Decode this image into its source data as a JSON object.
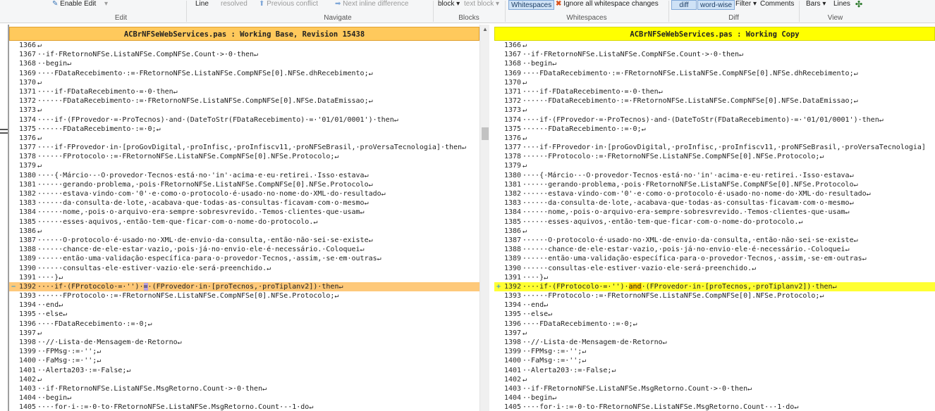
{
  "ribbon": {
    "enable_edit": "Enable Edit",
    "line": "Line",
    "resolved": "resolved",
    "previous_conflict": "Previous conflict",
    "next_inline_difference": "Next inline difference",
    "block": "block",
    "text_block": "text block",
    "whitespaces": "Whitespaces",
    "ignore_whitespace": "Ignore all whitespace changes",
    "diff": "diff",
    "word_wise": "word-wise",
    "filter": "Filter",
    "comments": "Comments",
    "bars": "Bars",
    "lines": "Lines",
    "groups": {
      "edit": "Edit",
      "navigate": "Navigate",
      "blocks": "Blocks",
      "whitespaces": "Whitespaces",
      "diff": "Diff",
      "view": "View"
    },
    "colors": {
      "accent": "#cfe2f6",
      "close_x": "#d9531e"
    },
    "icons": [
      "edit-icon",
      "up-arrow-icon",
      "right-arrow-icon",
      "close-x-icon",
      "bars-dropdown-icon",
      "lines-icon",
      "dropdown-chevron-icon"
    ]
  },
  "left_pane": {
    "title": "ACBrNFSeWebServices.pas : Working Base, Revision 15438",
    "header_color": "#ffc95c",
    "changed_color": "#fec97a",
    "highlight_color": "#b9a0e0",
    "marker": "−",
    "lines": [
      {
        "n": "1366",
        "t": "↵"
      },
      {
        "n": "1367",
        "t": "··if·FRetornoNFSe.ListaNFSe.CompNFSe.Count·>·0·then↵"
      },
      {
        "n": "1368",
        "t": "··begin↵"
      },
      {
        "n": "1369",
        "t": "····FDataRecebimento·:=·FRetornoNFSe.ListaNFSe.CompNFSe[0].NFSe.dhRecebimento;↵"
      },
      {
        "n": "1370",
        "t": "↵"
      },
      {
        "n": "1371",
        "t": "····if·FDataRecebimento·=·0·then↵"
      },
      {
        "n": "1372",
        "t": "······FDataRecebimento·:=·FRetornoNFSe.ListaNFSe.CompNFSe[0].NFSe.DataEmissao;↵"
      },
      {
        "n": "1373",
        "t": "↵"
      },
      {
        "n": "1374",
        "t": "····if·(FProvedor·=·ProTecnos)·and·(DateToStr(FDataRecebimento)·=·'01/01/0001')·then↵"
      },
      {
        "n": "1375",
        "t": "······FDataRecebimento·:=·0;↵"
      },
      {
        "n": "1376",
        "t": "↵"
      },
      {
        "n": "1377",
        "t": "····if·FProvedor·in·[proGovDigital,·proInfisc,·proInfiscv11,·proNFSeBrasil,·proVersaTecnologia]·then↵"
      },
      {
        "n": "1378",
        "t": "······FProtocolo·:=·FRetornoNFSe.ListaNFSe.CompNFSe[0].NFSe.Protocolo;↵"
      },
      {
        "n": "1379",
        "t": "↵"
      },
      {
        "n": "1380",
        "t": "····{·Márcio·-·O·provedor·Tecnos·está·no·'in'·acima·e·eu·retirei.·Isso·estava↵"
      },
      {
        "n": "1381",
        "t": "······gerando·problema,·pois·FRetornoNFSe.ListaNFSe.CompNFSe[0].NFSe.Protocolo↵"
      },
      {
        "n": "1382",
        "t": "······estava·vindo·com·'0'·e·como·o·protocolo·é·usado·no·nome·do·XML·do·resultado↵"
      },
      {
        "n": "1383",
        "t": "······da·consulta·de·lote,·acabava·que·todas·as·consultas·ficavam·com·o·mesmo↵"
      },
      {
        "n": "1384",
        "t": "······nome,·pois·o·arquivo·era·sempre·sobresvrevido.·Temos·clientes·que·usam↵"
      },
      {
        "n": "1385",
        "t": "······esses·aquivos,·então·tem·que·ficar·com·o·nome·do·protocolo.↵"
      },
      {
        "n": "1386",
        "t": "↵"
      },
      {
        "n": "1387",
        "t": "······O·protocolo·é·usado·no·XML·de·envio·da·consulta,·então·não·sei·se·existe↵"
      },
      {
        "n": "1388",
        "t": "······chance·de·ele·estar·vazio,·pois·já·no·envio·ele·é·necessário.·Coloquei↵"
      },
      {
        "n": "1389",
        "t": "······então·uma·validação·específica·para·o·provedor·Tecnos,·assim,·se·em·outras↵"
      },
      {
        "n": "1390",
        "t": "······consultas·ele·estiver·vazio·ele·será·preenchido.↵"
      },
      {
        "n": "1391",
        "t": "····}↵"
      },
      {
        "n": "1392",
        "a": "····if·(FProtocolo·=·'')·",
        "h": "=",
        "b": "·(FProvedor·in·[proTecnos,·proTiplanv2])·then↵",
        "changed": true
      },
      {
        "n": "1393",
        "t": "······FProtocolo·:=·FRetornoNFSe.ListaNFSe.CompNFSe[0].NFSe.Protocolo;↵"
      },
      {
        "n": "1394",
        "t": "··end↵"
      },
      {
        "n": "1395",
        "t": "··else↵"
      },
      {
        "n": "1396",
        "t": "····FDataRecebimento·:=·0;↵"
      },
      {
        "n": "1397",
        "t": "↵"
      },
      {
        "n": "1398",
        "t": "··//·Lista·de·Mensagem·de·Retorno↵"
      },
      {
        "n": "1399",
        "t": "··FPMsg·:=·'';↵"
      },
      {
        "n": "1400",
        "t": "··FaMsg·:=·'';↵"
      },
      {
        "n": "1401",
        "t": "··Alerta203·:=·False;↵"
      },
      {
        "n": "1402",
        "t": "↵"
      },
      {
        "n": "1403",
        "t": "··if·FRetornoNFSe.ListaNFSe.MsgRetorno.Count·>·0·then↵"
      },
      {
        "n": "1404",
        "t": "··begin↵"
      },
      {
        "n": "1405",
        "t": "····for·i·:=·0·to·FRetornoNFSe.ListaNFSe.MsgRetorno.Count·-·1·do↵"
      }
    ]
  },
  "right_pane": {
    "title": "ACBrNFSeWebServices.pas : Working Copy",
    "header_color": "#ffff00",
    "changed_color": "#ffff33",
    "highlight_color": "#ffd000",
    "marker": "+",
    "lines": [
      {
        "n": "1366",
        "t": "↵"
      },
      {
        "n": "1367",
        "t": "··if·FRetornoNFSe.ListaNFSe.CompNFSe.Count·>·0·then↵"
      },
      {
        "n": "1368",
        "t": "··begin↵"
      },
      {
        "n": "1369",
        "t": "····FDataRecebimento·:=·FRetornoNFSe.ListaNFSe.CompNFSe[0].NFSe.dhRecebimento;↵"
      },
      {
        "n": "1370",
        "t": "↵"
      },
      {
        "n": "1371",
        "t": "····if·FDataRecebimento·=·0·then↵"
      },
      {
        "n": "1372",
        "t": "······FDataRecebimento·:=·FRetornoNFSe.ListaNFSe.CompNFSe[0].NFSe.DataEmissao;↵"
      },
      {
        "n": "1373",
        "t": "↵"
      },
      {
        "n": "1374",
        "t": "····if·(FProvedor·=·ProTecnos)·and·(DateToStr(FDataRecebimento)·=·'01/01/0001')·then↵"
      },
      {
        "n": "1375",
        "t": "······FDataRecebimento·:=·0;↵"
      },
      {
        "n": "1376",
        "t": "↵"
      },
      {
        "n": "1377",
        "t": "····if·FProvedor·in·[proGovDigital,·proInfisc,·proInfiscv11,·proNFSeBrasil,·proVersaTecnologia]"
      },
      {
        "n": "1378",
        "t": "······FProtocolo·:=·FRetornoNFSe.ListaNFSe.CompNFSe[0].NFSe.Protocolo;↵"
      },
      {
        "n": "1379",
        "t": "↵"
      },
      {
        "n": "1380",
        "t": "····{·Márcio·-·O·provedor·Tecnos·está·no·'in'·acima·e·eu·retirei.·Isso·estava↵"
      },
      {
        "n": "1381",
        "t": "······gerando·problema,·pois·FRetornoNFSe.ListaNFSe.CompNFSe[0].NFSe.Protocolo↵"
      },
      {
        "n": "1382",
        "t": "······estava·vindo·com·'0'·e·como·o·protocolo·é·usado·no·nome·do·XML·do·resultado↵"
      },
      {
        "n": "1383",
        "t": "······da·consulta·de·lote,·acabava·que·todas·as·consultas·ficavam·com·o·mesmo↵"
      },
      {
        "n": "1384",
        "t": "······nome,·pois·o·arquivo·era·sempre·sobresvrevido.·Temos·clientes·que·usam↵"
      },
      {
        "n": "1385",
        "t": "······esses·aquivos,·então·tem·que·ficar·com·o·nome·do·protocolo.↵"
      },
      {
        "n": "1386",
        "t": "↵"
      },
      {
        "n": "1387",
        "t": "······O·protocolo·é·usado·no·XML·de·envio·da·consulta,·então·não·sei·se·existe↵"
      },
      {
        "n": "1388",
        "t": "······chance·de·ele·estar·vazio,·pois·já·no·envio·ele·é·necessário.·Coloquei↵"
      },
      {
        "n": "1389",
        "t": "······então·uma·validação·específica·para·o·provedor·Tecnos,·assim,·se·em·outras↵"
      },
      {
        "n": "1390",
        "t": "······consultas·ele·estiver·vazio·ele·será·preenchido.↵"
      },
      {
        "n": "1391",
        "t": "····}↵"
      },
      {
        "n": "1392",
        "a": "····if·(FProtocolo·=·'')·",
        "h": "and",
        "b": "·(FProvedor·in·[proTecnos,·proTiplanv2])·then↵",
        "changed": true
      },
      {
        "n": "1393",
        "t": "······FProtocolo·:=·FRetornoNFSe.ListaNFSe.CompNFSe[0].NFSe.Protocolo;↵"
      },
      {
        "n": "1394",
        "t": "··end↵"
      },
      {
        "n": "1395",
        "t": "··else↵"
      },
      {
        "n": "1396",
        "t": "····FDataRecebimento·:=·0;↵"
      },
      {
        "n": "1397",
        "t": "↵"
      },
      {
        "n": "1398",
        "t": "··//·Lista·de·Mensagem·de·Retorno↵"
      },
      {
        "n": "1399",
        "t": "··FPMsg·:=·'';↵"
      },
      {
        "n": "1400",
        "t": "··FaMsg·:=·'';↵"
      },
      {
        "n": "1401",
        "t": "··Alerta203·:=·False;↵"
      },
      {
        "n": "1402",
        "t": "↵"
      },
      {
        "n": "1403",
        "t": "··if·FRetornoNFSe.ListaNFSe.MsgRetorno.Count·>·0·then↵"
      },
      {
        "n": "1404",
        "t": "··begin↵"
      },
      {
        "n": "1405",
        "t": "····for·i·:=·0·to·FRetornoNFSe.ListaNFSe.MsgRetorno.Count·-·1·do↵"
      }
    ]
  }
}
